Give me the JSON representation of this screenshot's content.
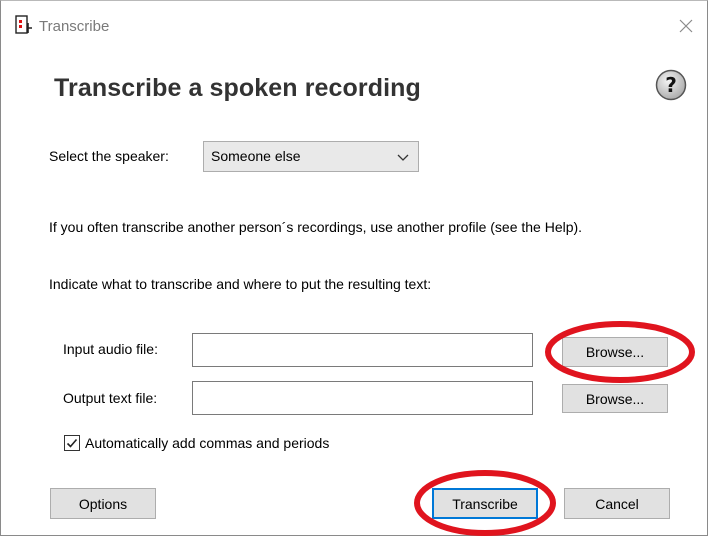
{
  "window": {
    "title": "Transcribe"
  },
  "dialog": {
    "heading": "Transcribe a spoken recording",
    "speaker_label": "Select the speaker:",
    "speaker_selected": "Someone else",
    "profile_note": "If you often transcribe another person´s recordings, use another profile (see the Help).",
    "indicate_note": "Indicate what to transcribe and where to put the resulting text:",
    "input_label": "Input audio file:",
    "input_value": "",
    "output_label": "Output text file:",
    "output_value": "",
    "browse_label": "Browse...",
    "auto_punct_label": "Automatically add commas and periods",
    "auto_punct_checked": true
  },
  "buttons": {
    "options": "Options",
    "transcribe": "Transcribe",
    "cancel": "Cancel"
  },
  "icons": {
    "app": "app-document-icon",
    "close": "close-icon",
    "help": "help-question-icon",
    "dropdown": "chevron-down-icon",
    "check": "checkmark-icon"
  },
  "colors": {
    "highlight_ring": "#e0141e",
    "default_button_border": "#0078d7",
    "button_face": "#e1e1e1"
  }
}
